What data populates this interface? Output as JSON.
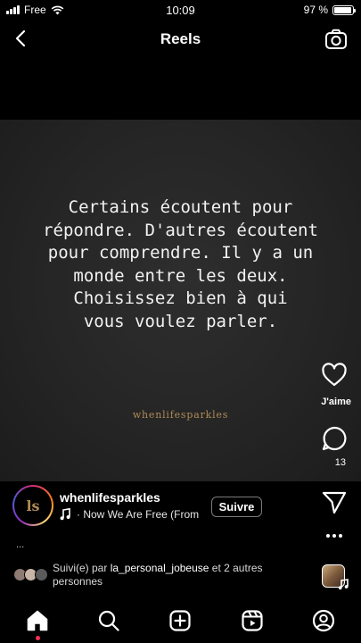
{
  "status_bar": {
    "carrier": "Free",
    "time": "10:09",
    "battery": "97 %",
    "battery_level": 0.97
  },
  "header": {
    "title": "Reels"
  },
  "reel": {
    "quote_lines": [
      "Certains écoutent pour",
      "répondre. D'autres écoutent",
      "pour comprendre. Il y a un",
      "monde entre les deux.",
      "Choisissez bien à qui",
      "vous voulez parler."
    ],
    "watermark": "whenlifesparkles"
  },
  "actions": {
    "like_label": "J'aime",
    "comment_count": "13"
  },
  "account": {
    "username": "whenlifesparkles",
    "avatar_logo": "ls",
    "music": "· Now We Are Free (From",
    "follow_label": "Suivre"
  },
  "caption": {
    "more": "..."
  },
  "followed_by": {
    "prefix": "Suivi(e) par ",
    "user": "la_personal_jobeuse",
    "suffix": " et 2 autres personnes"
  },
  "nav": {
    "items": [
      "home-icon",
      "search-icon",
      "create-icon",
      "reels-icon",
      "profile-icon"
    ]
  },
  "colors": {
    "background": "#000000",
    "watermark": "#b08a55",
    "notification_dot": "#ff2d55"
  }
}
